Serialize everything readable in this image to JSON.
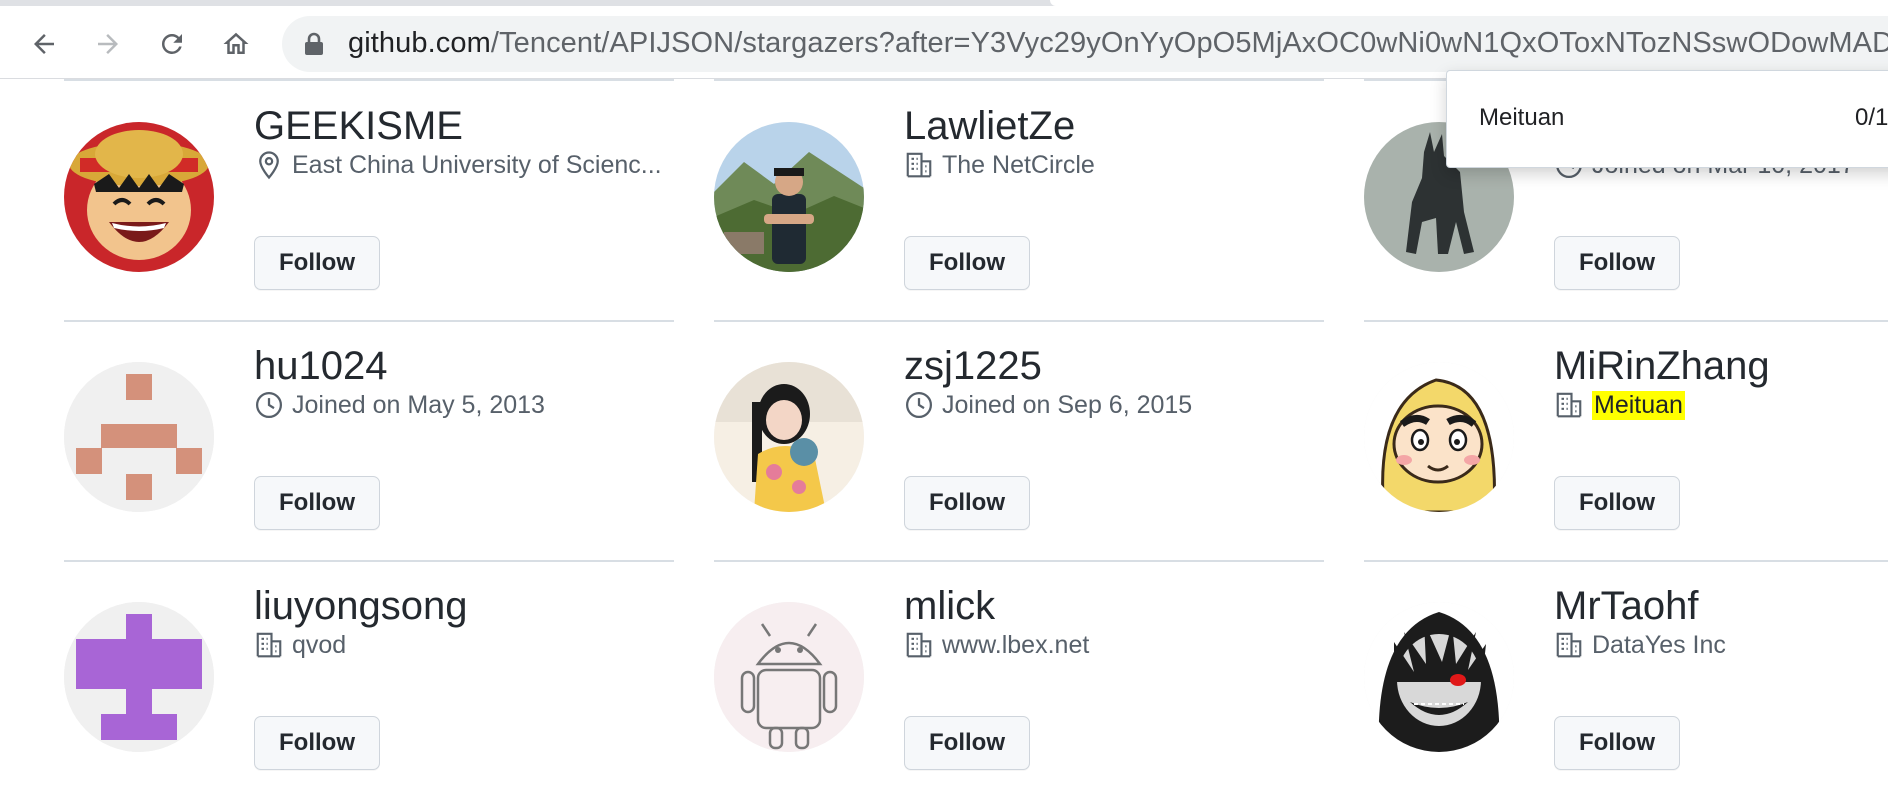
{
  "browser": {
    "url_host": "github.com",
    "url_rest": "/Tencent/APIJSON/stargazers?after=Y3Vyc29yOnYyOpO5MjAxOC0wNi0wN1QxOToxNTozNSswODowMAD",
    "icons": [
      "back-icon",
      "forward-icon",
      "reload-icon",
      "home-icon",
      "lock-icon"
    ]
  },
  "find_popup": {
    "query": "Meituan",
    "count": "0/1"
  },
  "users": [
    {
      "name": "GEEKISME",
      "meta_icon": "location-icon",
      "meta": "East China University of Scienc...",
      "follow_label": "Follow"
    },
    {
      "name": "LawlietZe",
      "meta_icon": "organization-icon",
      "meta": "The NetCircle",
      "follow_label": "Follow"
    },
    {
      "name": "",
      "meta_icon": "clock-icon",
      "meta": "Joined on Mar 10, 2017",
      "follow_label": "Follow"
    },
    {
      "name": "hu1024",
      "meta_icon": "clock-icon",
      "meta": "Joined on May 5, 2013",
      "follow_label": "Follow"
    },
    {
      "name": "zsj1225",
      "meta_icon": "clock-icon",
      "meta": "Joined on Sep 6, 2015",
      "follow_label": "Follow"
    },
    {
      "name": "MiRinZhang",
      "meta_icon": "organization-icon",
      "meta": "Meituan",
      "meta_highlighted": true,
      "follow_label": "Follow"
    },
    {
      "name": "liuyongsong",
      "meta_icon": "organization-icon",
      "meta": "qvod",
      "follow_label": "Follow"
    },
    {
      "name": "mlick",
      "meta_icon": "organization-icon",
      "meta": "www.lbex.net",
      "follow_label": "Follow"
    },
    {
      "name": "MrTaohf",
      "meta_icon": "organization-icon",
      "meta": "DataYes Inc",
      "follow_label": "Follow"
    }
  ],
  "colors": {
    "highlight": "#ffff00",
    "identicon_hu1024": "#d4917b",
    "identicon_liuyongsong": "#a865d6"
  }
}
